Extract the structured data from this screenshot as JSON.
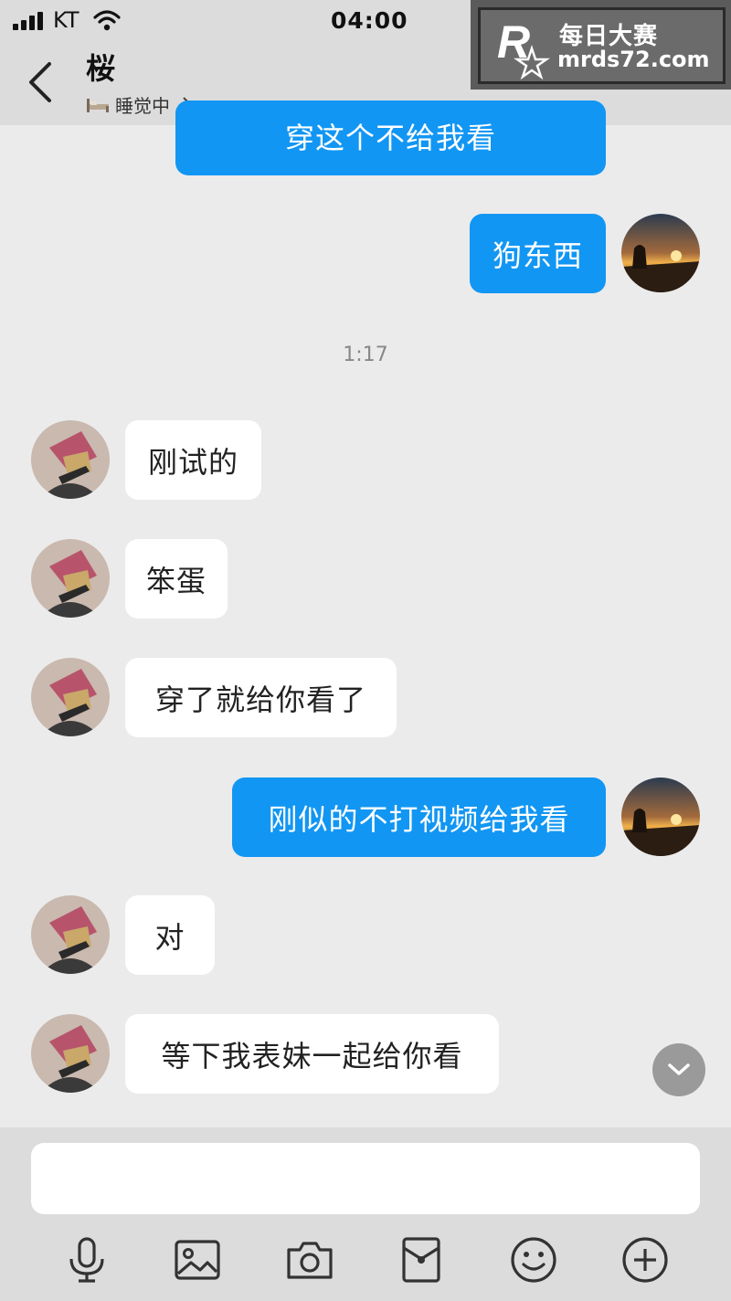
{
  "status_bar": {
    "carrier": "KT",
    "time": "04:00"
  },
  "header": {
    "contact_name": "桜",
    "contact_status": "睡觉中"
  },
  "watermark": {
    "title": "每日大赛",
    "url": "mrds72.com",
    "logo_letter": "R"
  },
  "messages": [
    {
      "from": "me",
      "text": "穿这个不给我看"
    },
    {
      "from": "me",
      "text": "狗东西"
    },
    {
      "from": "them",
      "text": "刚试的"
    },
    {
      "from": "them",
      "text": "笨蛋"
    },
    {
      "from": "them",
      "text": "穿了就给你看了"
    },
    {
      "from": "me",
      "text": "刚似的不打视频给我看"
    },
    {
      "from": "them",
      "text": "对"
    },
    {
      "from": "them",
      "text": "等下我表妹一起给你看"
    }
  ],
  "timestamp": "1:17",
  "toolbar": [
    "microphone-icon",
    "image-icon",
    "camera-icon",
    "red-packet-icon",
    "emoji-icon",
    "plus-icon"
  ],
  "colors": {
    "outgoing_bubble": "#1296f3",
    "incoming_bubble": "#ffffff",
    "background": "#ebebeb",
    "header": "#dcdcdc"
  }
}
